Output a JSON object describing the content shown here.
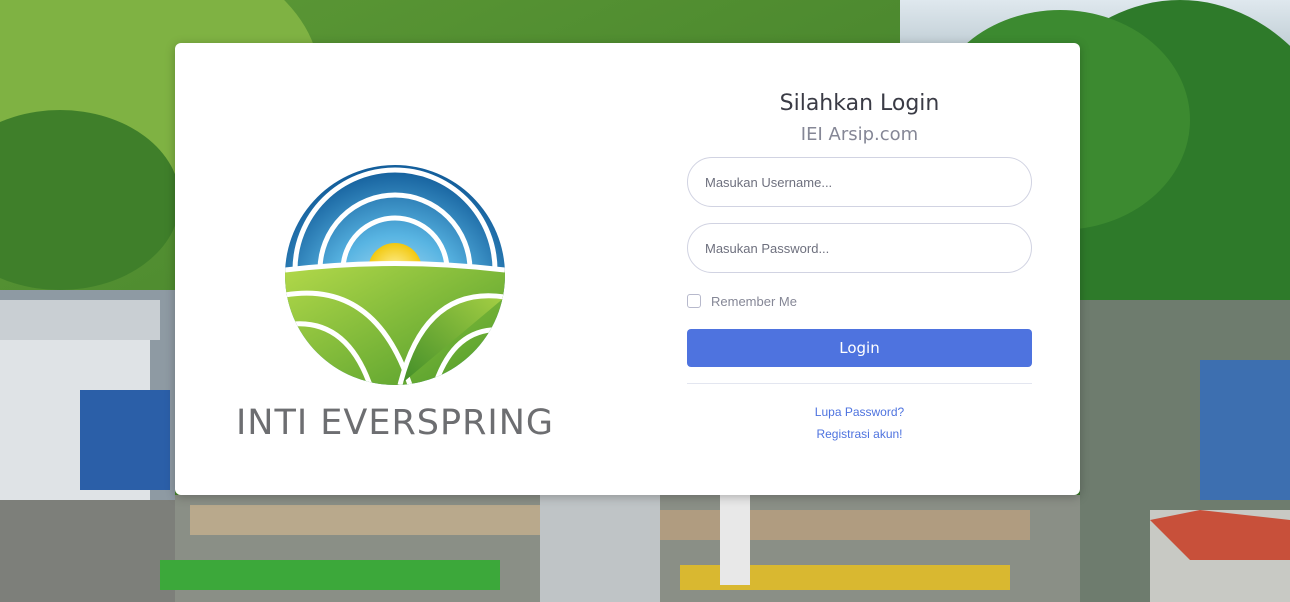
{
  "brand": {
    "name": "INTI EVERSPRING",
    "logo_icon": "sun-over-fields-logo",
    "colors": {
      "sky_dark": "#1f6fa6",
      "sky_light": "#7cc8ec",
      "sun": "#f5d63a",
      "field_light": "#9acd3c",
      "field_dark": "#5aa02c",
      "text": "#6d6e71"
    }
  },
  "login": {
    "title": "Silahkan Login",
    "subtitle": "IEI Arsip.com",
    "username_placeholder": "Masukan Username...",
    "password_placeholder": "Masukan Password...",
    "remember_label": "Remember Me",
    "submit_label": "Login",
    "forgot_link": "Lupa Password?",
    "register_link": "Registrasi akun!",
    "accent_color": "#4e73df"
  },
  "background": {
    "description_icon": "industrial-plant-photo"
  }
}
